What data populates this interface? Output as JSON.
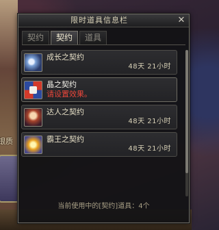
{
  "background": {
    "side_text": "银质"
  },
  "panel": {
    "title": "限时道具信息栏",
    "close_glyph": "✕",
    "tabs": [
      {
        "label": "契约",
        "active": false
      },
      {
        "label": "契约",
        "active": true
      },
      {
        "label": "道具",
        "active": false
      }
    ],
    "items": [
      {
        "name": "成长之契约",
        "subtitle": "",
        "time": "48天 21小时",
        "icon": "growth-contract-icon"
      },
      {
        "name": "晶之契约",
        "subtitle": "请设置效果。",
        "time": "",
        "icon": "crystal-contract-icon"
      },
      {
        "name": "达人之契约",
        "subtitle": "",
        "time": "48天 21小时",
        "icon": "master-contract-icon"
      },
      {
        "name": "霸王之契约",
        "subtitle": "",
        "time": "48天 21小时",
        "icon": "overlord-contract-icon"
      }
    ],
    "footer": "当前使用中的[契约]道具：4个"
  },
  "colors": {
    "accent_text": "#d9d2b8",
    "warning_text": "#e8463a",
    "panel_bg": "#121214"
  }
}
